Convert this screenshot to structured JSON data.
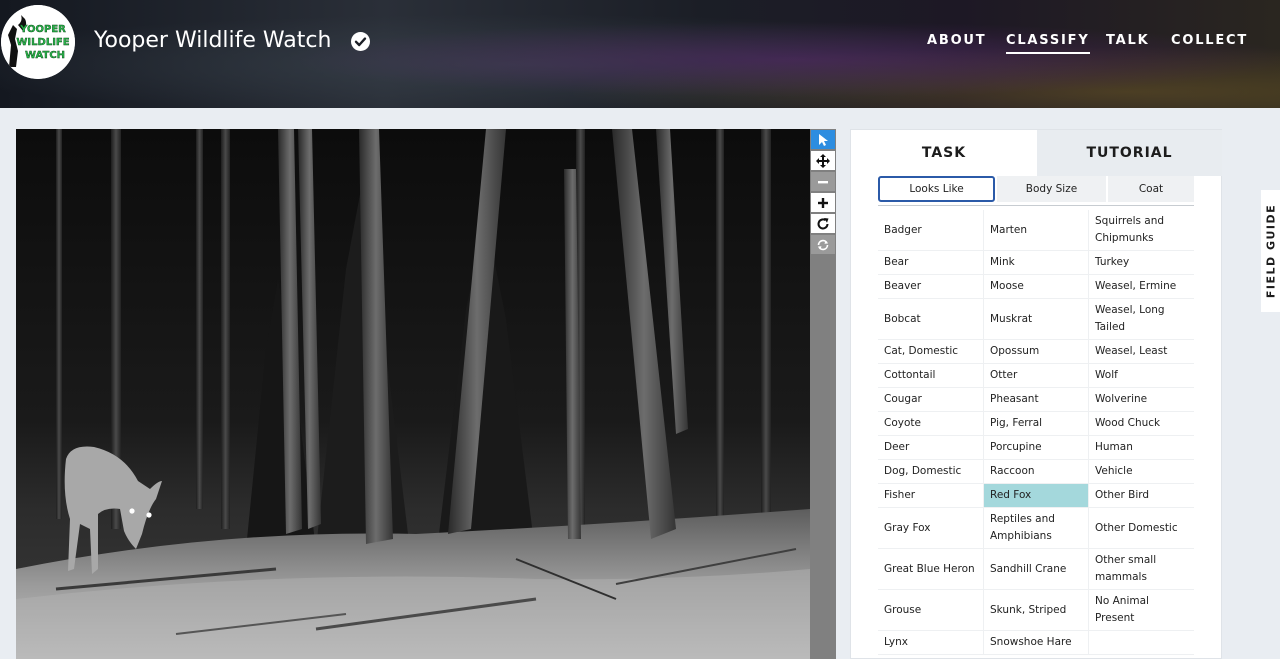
{
  "header": {
    "logo_text": [
      "YOOPER",
      "WILDLIFE",
      "WATCH"
    ],
    "title": "Yooper Wildlife Watch",
    "verified_icon": "check-circle-icon",
    "nav": [
      {
        "label": "ABOUT",
        "active": false
      },
      {
        "label": "CLASSIFY",
        "active": true
      },
      {
        "label": "TALK",
        "active": false
      },
      {
        "label": "COLLECT",
        "active": false
      }
    ]
  },
  "viewer": {
    "image_description_icon": "trail-camera-photo",
    "tools": [
      {
        "icon": "pointer-icon",
        "active": true,
        "disabled": false
      },
      {
        "icon": "move-icon",
        "active": false,
        "disabled": false
      },
      {
        "icon": "zoom-out-icon",
        "active": false,
        "disabled": true
      },
      {
        "icon": "zoom-in-icon",
        "active": false,
        "disabled": false
      },
      {
        "icon": "rotate-icon",
        "active": false,
        "disabled": false
      },
      {
        "icon": "reset-icon",
        "active": false,
        "disabled": true
      }
    ]
  },
  "task_panel": {
    "tabs": [
      {
        "label": "TASK",
        "active": true
      },
      {
        "label": "TUTORIAL",
        "active": false
      }
    ],
    "filters": [
      {
        "label": "Looks Like",
        "selected": true
      },
      {
        "label": "Body Size",
        "selected": false
      },
      {
        "label": "Coat",
        "selected": false
      }
    ],
    "choices": [
      [
        "Badger",
        "Marten",
        "Squirrels and Chipmunks"
      ],
      [
        "Bear",
        "Mink",
        "Turkey"
      ],
      [
        "Beaver",
        "Moose",
        "Weasel, Ermine"
      ],
      [
        "Bobcat",
        "Muskrat",
        "Weasel, Long Tailed"
      ],
      [
        "Cat, Domestic",
        "Opossum",
        "Weasel, Least"
      ],
      [
        "Cottontail",
        "Otter",
        "Wolf"
      ],
      [
        "Cougar",
        "Pheasant",
        "Wolverine"
      ],
      [
        "Coyote",
        "Pig, Ferral",
        "Wood Chuck"
      ],
      [
        "Deer",
        "Porcupine",
        "Human"
      ],
      [
        "Dog, Domestic",
        "Raccoon",
        "Vehicle"
      ],
      [
        "Fisher",
        "Red Fox",
        "Other Bird"
      ],
      [
        "Gray Fox",
        "Reptiles and Amphibians",
        "Other Domestic"
      ],
      [
        "Great Blue Heron",
        "Sandhill Crane",
        "Other small mammals"
      ],
      [
        "Grouse",
        "Skunk, Striped",
        "No Animal Present"
      ],
      [
        "Lynx",
        "Snowshoe Hare",
        ""
      ]
    ],
    "selected_choice": "Red Fox"
  },
  "field_guide": {
    "label": "FIELD GUIDE"
  },
  "colors": {
    "selected_choice_bg": "#a4d8dc",
    "active_tool_bg": "#2d8de0",
    "filter_selected_border": "#2b5aa8"
  }
}
